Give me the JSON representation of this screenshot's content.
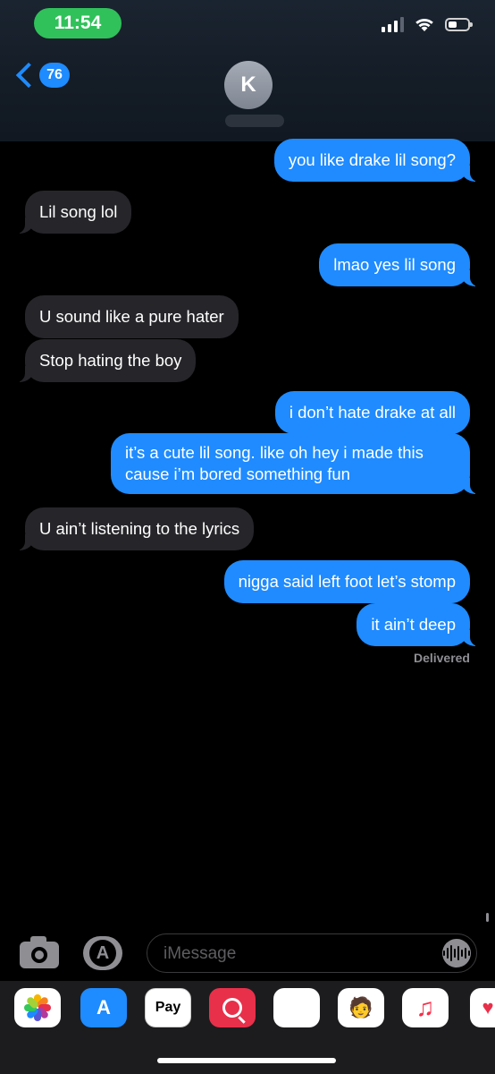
{
  "status_bar": {
    "time": "11:54"
  },
  "header": {
    "back_count": "76",
    "contact_initial": "K"
  },
  "messages": [
    {
      "text": "you like drake lil song?"
    },
    {
      "text": "Lil song lol"
    },
    {
      "text": "lmao yes lil song"
    },
    {
      "text": "U sound like a pure hater"
    },
    {
      "text": "Stop hating the boy"
    },
    {
      "text": "i don’t hate drake at all"
    },
    {
      "text": "it’s a cute lil song. like oh hey i made this cause i’m bored something fun"
    },
    {
      "text": "U ain’t listening to the lyrics"
    },
    {
      "text": "nigga said left foot let’s stomp"
    },
    {
      "text": "it ain’t deep"
    }
  ],
  "delivered_label": "Delivered",
  "compose": {
    "placeholder": "iMessage"
  },
  "app_drawer": {
    "apps": [
      "photos-icon",
      "app-store-icon",
      "apple-pay-icon",
      "web-search-icon",
      "animoji-icon",
      "memoji-icon",
      "music-icon",
      "digital-touch-icon"
    ],
    "apple_pay_label": "Pay"
  },
  "colors": {
    "sent_bubble": "#1f8bff",
    "received_bubble": "#26262a",
    "time_pill": "#30c15a",
    "accent": "#1e8bff"
  }
}
